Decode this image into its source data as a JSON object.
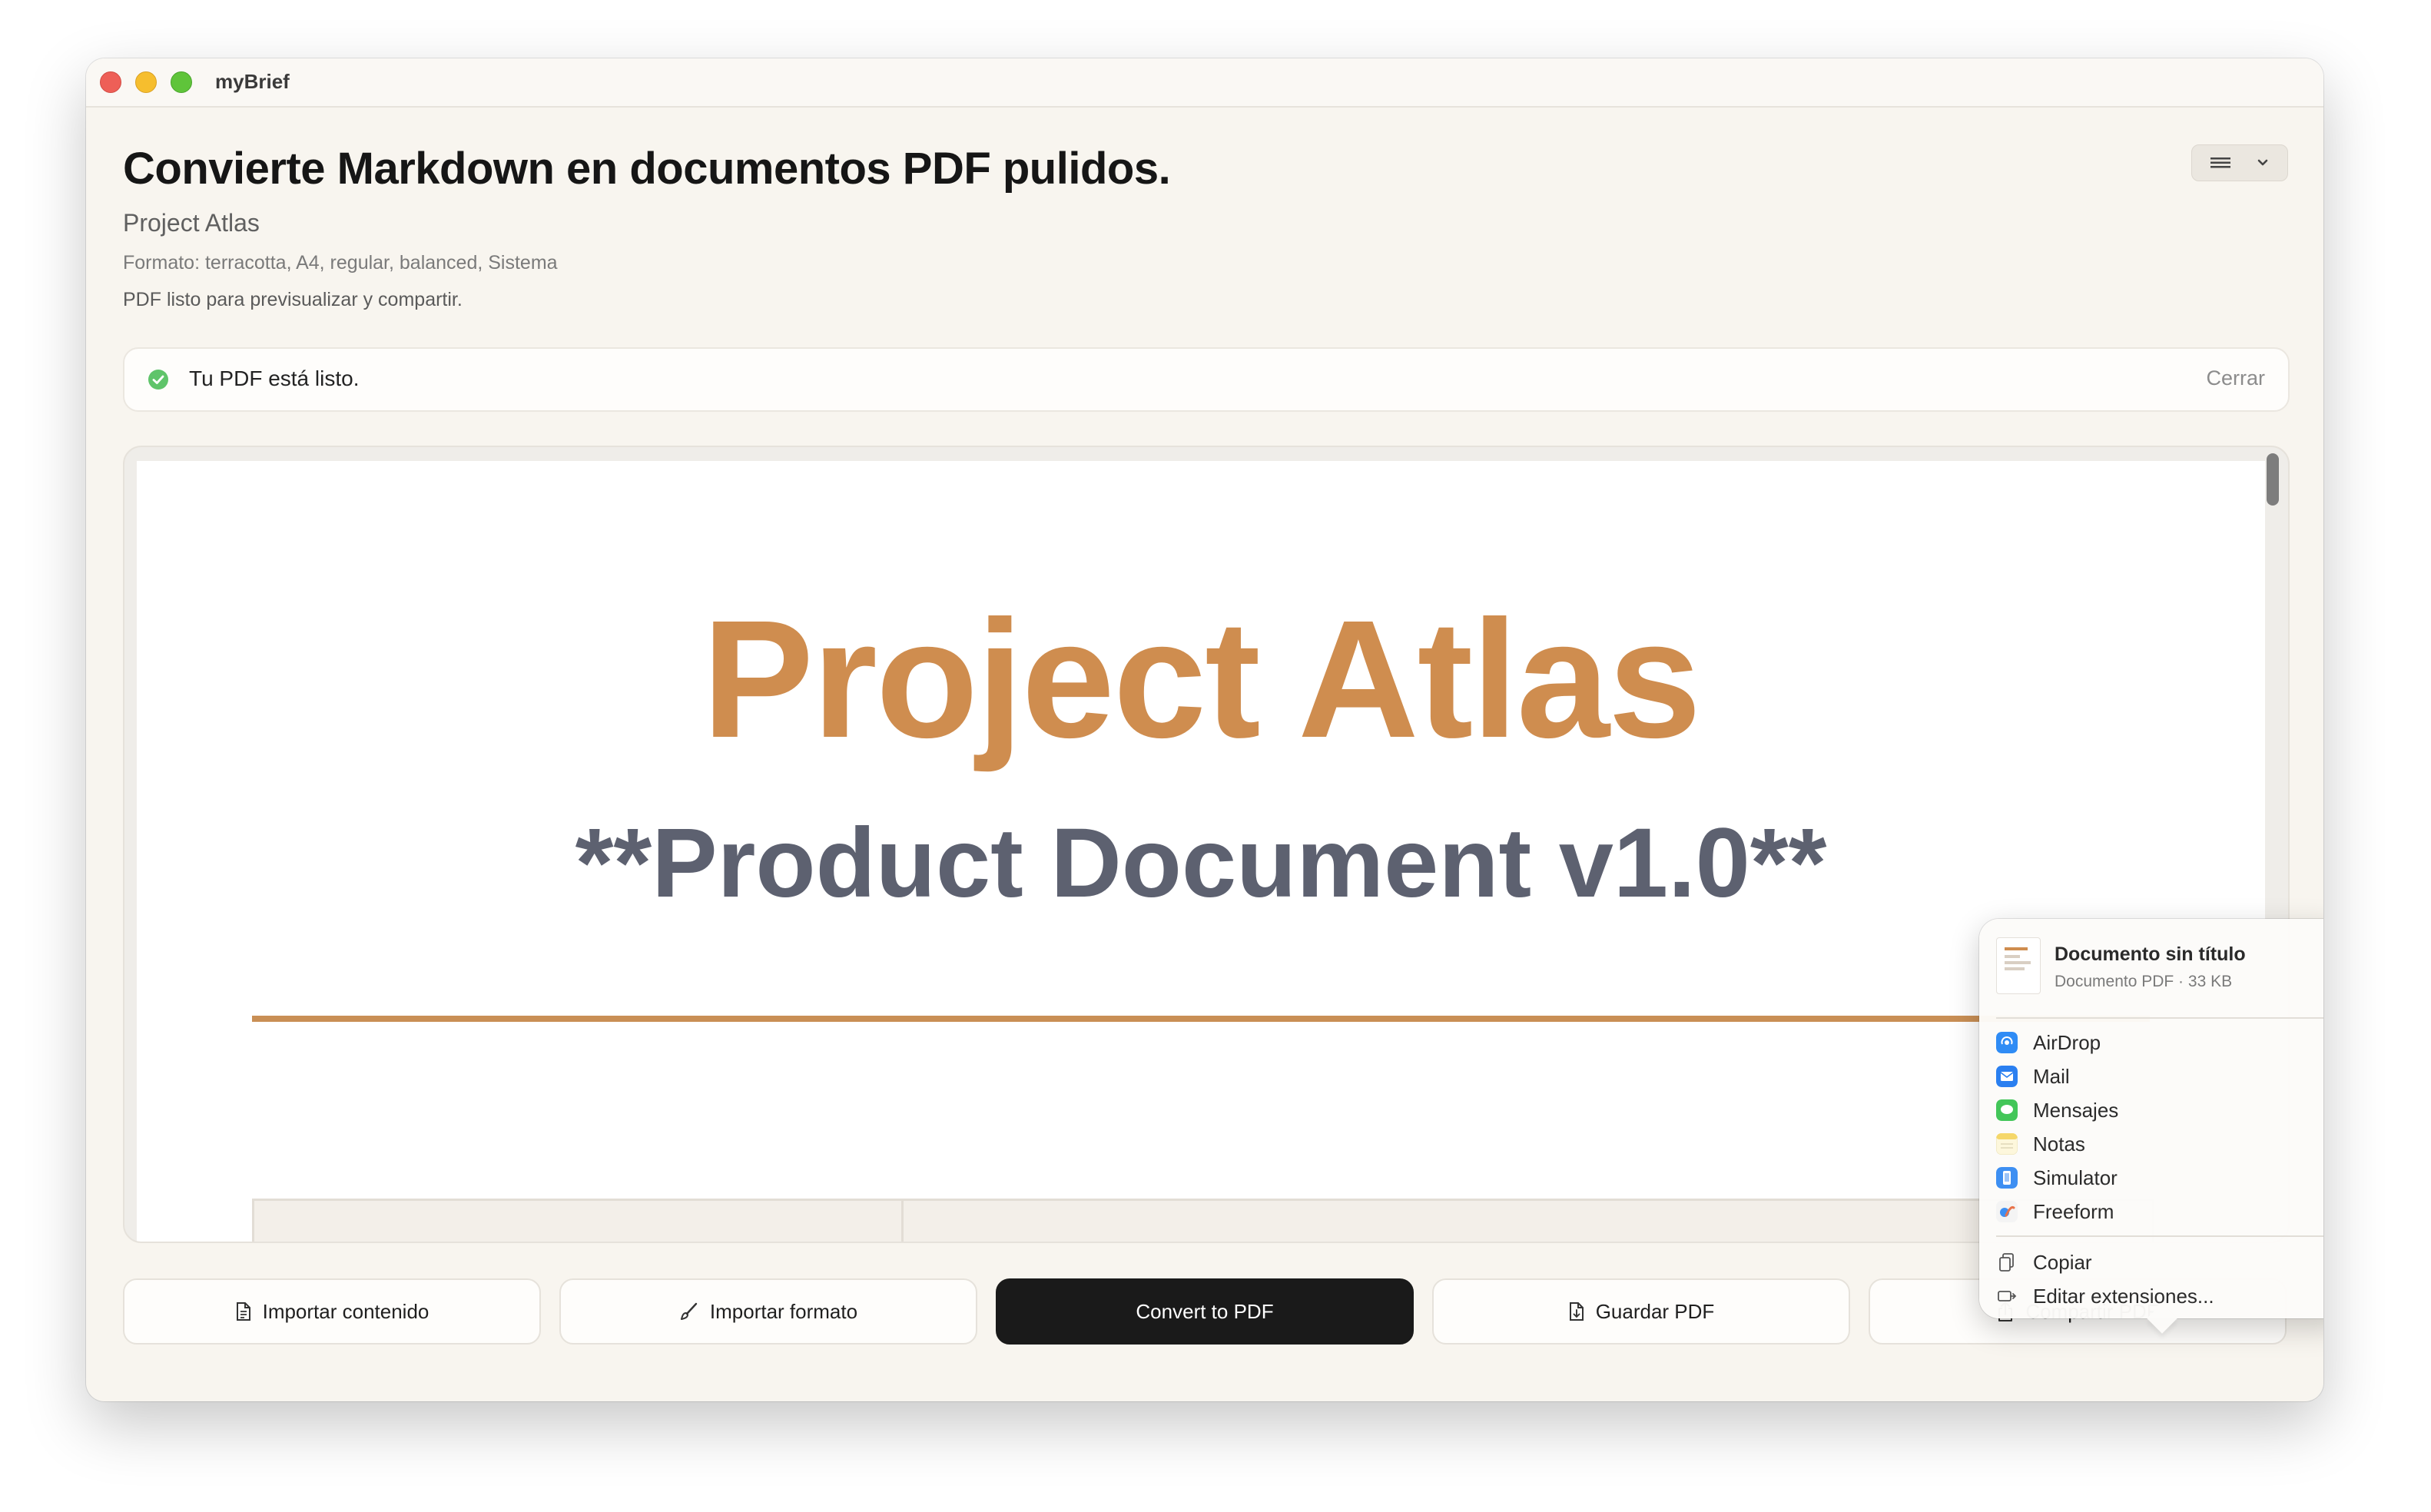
{
  "window": {
    "title": "myBrief"
  },
  "header": {
    "headline": "Convierte Markdown en documentos PDF pulidos.",
    "project_name": "Project Atlas",
    "format_line": "Formato: terracotta, A4, regular, balanced, Sistema",
    "status_line": "PDF listo para previsualizar y compartir."
  },
  "banner": {
    "message": "Tu PDF está listo.",
    "close_label": "Cerrar",
    "success_color": "#5fc46a"
  },
  "preview": {
    "doc_title": "Project Atlas",
    "doc_subtitle": "**Product Document v1.0**",
    "accent_color": "#cf8d4f"
  },
  "actions": {
    "import_content": "Importar contenido",
    "import_format": "Importar formato",
    "convert": "Convert to PDF",
    "save": "Guardar PDF",
    "share": "Compartir PDF"
  },
  "share_menu": {
    "file_name": "Documento sin título",
    "file_info": "Documento PDF · 33 KB",
    "apps": [
      {
        "label": "AirDrop",
        "icon": "airdrop-icon",
        "color": "#2f8cf5"
      },
      {
        "label": "Mail",
        "icon": "mail-icon",
        "color": "#2a7ff0"
      },
      {
        "label": "Mensajes",
        "icon": "messages-icon",
        "color": "#43c659"
      },
      {
        "label": "Notas",
        "icon": "notes-icon",
        "color": "#f5d76a"
      },
      {
        "label": "Simulator",
        "icon": "simulator-icon",
        "color": "#3d8ff2"
      },
      {
        "label": "Freeform",
        "icon": "freeform-icon",
        "color": "#e8734a"
      }
    ],
    "copy": "Copiar",
    "edit_extensions": "Editar extensiones..."
  }
}
